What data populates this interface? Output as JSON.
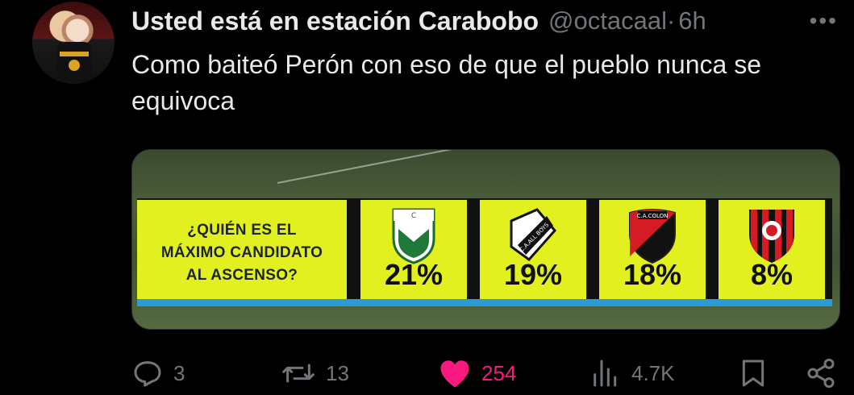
{
  "tweet": {
    "display_name": "Usted está en estación Carabobo",
    "handle": "@octacaal",
    "separator": "·",
    "time": "6h",
    "more": "•••",
    "text": "Como baiteó Perón con eso de que el pueblo nunca se equivoca"
  },
  "media": {
    "question_lines": [
      "¿QUIÉN ES EL",
      "MÁXIMO CANDIDATO",
      "AL ASCENSO?"
    ],
    "teams": [
      {
        "percent": "21%",
        "value": 21
      },
      {
        "percent": "19%",
        "value": 19
      },
      {
        "percent": "18%",
        "value": 18
      },
      {
        "percent": "8%",
        "value": 8
      }
    ],
    "colors": {
      "panel": "#e3f01f",
      "bar": "#2c9ad8",
      "divider": "#111111"
    }
  },
  "actions": {
    "reply": {
      "icon": "reply-icon",
      "count": "3"
    },
    "retweet": {
      "icon": "retweet-icon",
      "count": "13"
    },
    "like": {
      "icon": "heart-icon",
      "count": "254",
      "color": "#f91880"
    },
    "views": {
      "icon": "views-icon",
      "count": "4.7K"
    },
    "bookmark": {
      "icon": "bookmark-icon"
    },
    "share": {
      "icon": "share-icon"
    }
  }
}
